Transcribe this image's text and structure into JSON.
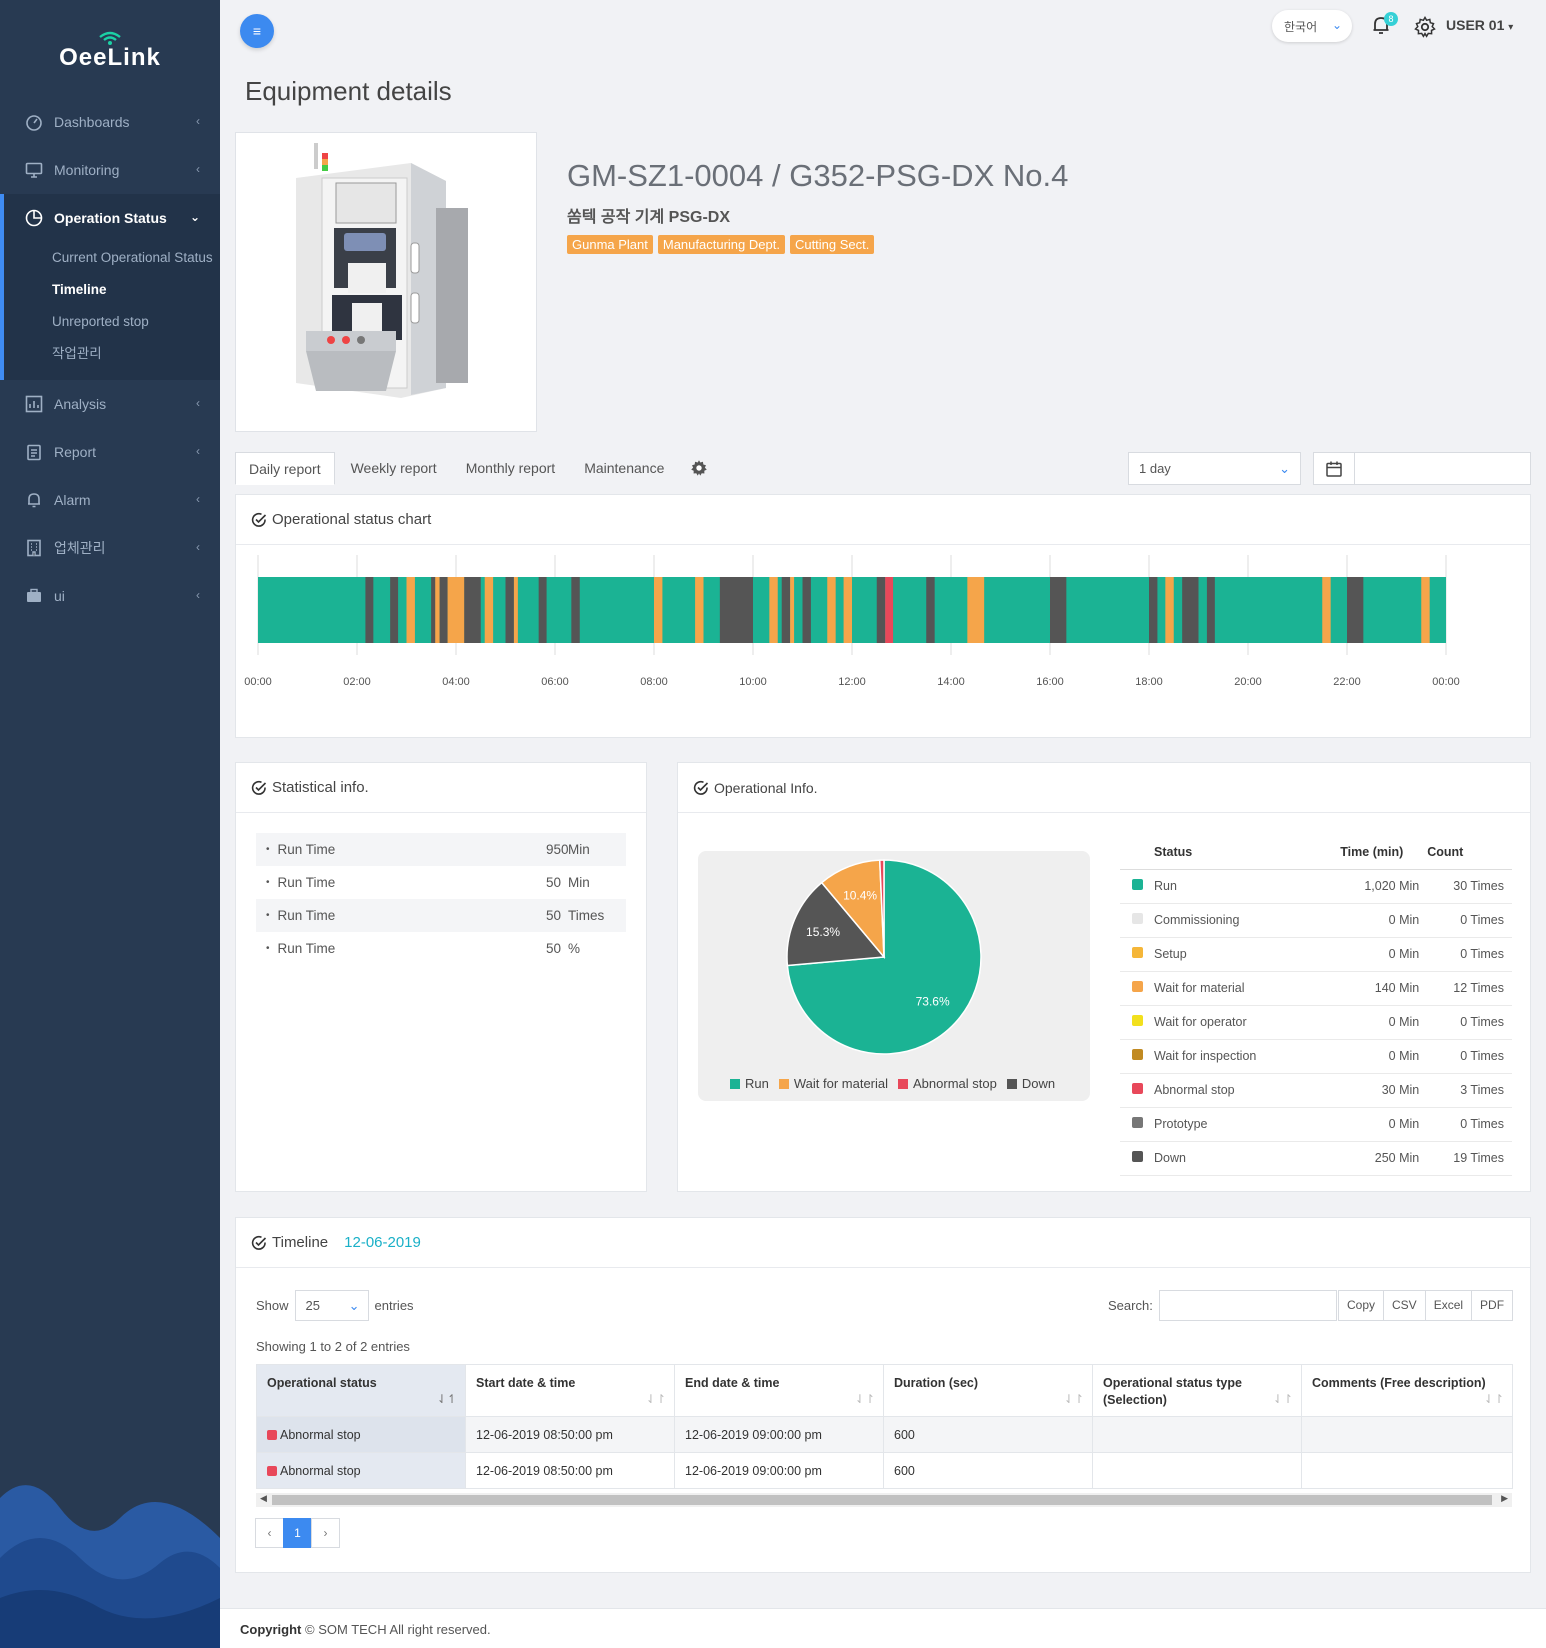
{
  "app": {
    "logo": "OeeLink"
  },
  "sidebar": {
    "items": [
      {
        "label": "Dashboards"
      },
      {
        "label": "Monitoring"
      },
      {
        "label": "Operation Status"
      },
      {
        "label": "Analysis"
      },
      {
        "label": "Report"
      },
      {
        "label": "Alarm"
      },
      {
        "label": "업체관리"
      },
      {
        "label": "ui"
      }
    ],
    "sub_items": [
      {
        "label": "Current Operational Status"
      },
      {
        "label": "Timeline"
      },
      {
        "label": "Unreported stop"
      },
      {
        "label": "작업관리"
      }
    ]
  },
  "topbar": {
    "language": "한국어",
    "notifications": "8",
    "user": "USER 01"
  },
  "page": {
    "title": "Equipment details"
  },
  "equipment": {
    "name": "GM-SZ1-0004 / G352-PSG-DX No.4",
    "subtitle": "쏨텍 공작 기계 PSG-DX",
    "tags": [
      "Gunma Plant",
      "Manufacturing Dept.",
      "Cutting Sect."
    ]
  },
  "tabs": [
    "Daily report",
    "Weekly report",
    "Monthly report",
    "Maintenance"
  ],
  "range": {
    "value": "1 day"
  },
  "status_chart": {
    "title": "Operational status chart",
    "ticks": [
      "00:00",
      "02:00",
      "04:00",
      "06:00",
      "08:00",
      "10:00",
      "12:00",
      "14:00",
      "16:00",
      "18:00",
      "20:00",
      "22:00",
      "00:00"
    ],
    "colors": {
      "run": "#1bb394",
      "wait": "#f5a54a",
      "down": "#555555",
      "abnormal": "#e8485a"
    },
    "segments": [
      {
        "s": 2.17,
        "e": 2.33,
        "t": "down"
      },
      {
        "s": 2.67,
        "e": 2.83,
        "t": "down"
      },
      {
        "s": 3.0,
        "e": 3.17,
        "t": "wait"
      },
      {
        "s": 3.5,
        "e": 3.67,
        "t": "down"
      },
      {
        "s": 3.5,
        "e": 3.67,
        "t": "down"
      },
      {
        "s": 3.58,
        "e": 3.67,
        "t": "wait"
      },
      {
        "s": 3.67,
        "e": 3.83,
        "t": "down"
      },
      {
        "s": 3.83,
        "e": 4.17,
        "t": "wait"
      },
      {
        "s": 4.17,
        "e": 4.33,
        "t": "down"
      },
      {
        "s": 4.17,
        "e": 4.17,
        "t": "down"
      },
      {
        "s": 4.17,
        "e": 4.33,
        "t": "down"
      },
      {
        "s": 4.17,
        "e": 4.5,
        "t": "down"
      },
      {
        "s": 4.58,
        "e": 4.75,
        "t": "wait"
      },
      {
        "s": 5.0,
        "e": 5.17,
        "t": "down"
      },
      {
        "s": 5.17,
        "e": 5.25,
        "t": "wait"
      },
      {
        "s": 5.67,
        "e": 5.83,
        "t": "down"
      },
      {
        "s": 6.33,
        "e": 6.5,
        "t": "down"
      },
      {
        "s": 8.0,
        "e": 8.17,
        "t": "wait"
      },
      {
        "s": 8.83,
        "e": 9.0,
        "t": "wait"
      },
      {
        "s": 9.33,
        "e": 10.0,
        "t": "down"
      },
      {
        "s": 10.33,
        "e": 10.5,
        "t": "wait"
      },
      {
        "s": 10.58,
        "e": 10.75,
        "t": "down"
      },
      {
        "s": 10.75,
        "e": 10.83,
        "t": "wait"
      },
      {
        "s": 11.0,
        "e": 11.17,
        "t": "down"
      },
      {
        "s": 11.5,
        "e": 11.67,
        "t": "wait"
      },
      {
        "s": 11.83,
        "e": 12.0,
        "t": "wait"
      },
      {
        "s": 12.5,
        "e": 12.67,
        "t": "down"
      },
      {
        "s": 12.67,
        "e": 12.83,
        "t": "abnormal"
      },
      {
        "s": 13.5,
        "e": 13.67,
        "t": "down"
      },
      {
        "s": 14.33,
        "e": 14.67,
        "t": "wait"
      },
      {
        "s": 16.0,
        "e": 16.33,
        "t": "down"
      },
      {
        "s": 18.0,
        "e": 18.17,
        "t": "down"
      },
      {
        "s": 18.33,
        "e": 18.5,
        "t": "wait"
      },
      {
        "s": 18.67,
        "e": 19.0,
        "t": "down"
      },
      {
        "s": 19.17,
        "e": 19.33,
        "t": "down"
      },
      {
        "s": 21.5,
        "e": 21.67,
        "t": "wait"
      },
      {
        "s": 22.0,
        "e": 22.33,
        "t": "down"
      },
      {
        "s": 23.5,
        "e": 23.67,
        "t": "wait"
      }
    ]
  },
  "statistics": {
    "title": "Statistical info.",
    "rows": [
      {
        "label": "Run Time",
        "value": "950",
        "unit": "Min"
      },
      {
        "label": "Run Time",
        "value": "50",
        "unit": "Min"
      },
      {
        "label": "Run Time",
        "value": "50",
        "unit": "Times"
      },
      {
        "label": "Run Time",
        "value": "50",
        "unit": "%"
      }
    ]
  },
  "operational_info": {
    "title": "Operational Info.",
    "columns": [
      "Status",
      "Time (min)",
      "Count"
    ],
    "rows": [
      {
        "color": "#1bb394",
        "status": "Run",
        "time": "1,020 Min",
        "count": "30 Times"
      },
      {
        "color": "#e6e6e6",
        "status": "Commissioning",
        "time": "0 Min",
        "count": "0 Times"
      },
      {
        "color": "#f5b638",
        "status": "Setup",
        "time": "0 Min",
        "count": "0 Times"
      },
      {
        "color": "#f5a54a",
        "status": "Wait for material",
        "time": "140 Min",
        "count": "12 Times"
      },
      {
        "color": "#f2e01d",
        "status": "Wait for operator",
        "time": "0 Min",
        "count": "0 Times"
      },
      {
        "color": "#c18a22",
        "status": "Wait for inspection",
        "time": "0 Min",
        "count": "0 Times"
      },
      {
        "color": "#e8485a",
        "status": "Abnormal stop",
        "time": "30 Min",
        "count": "3 Times"
      },
      {
        "color": "#777777",
        "status": "Prototype",
        "time": "0 Min",
        "count": "0 Times"
      },
      {
        "color": "#555555",
        "status": "Down",
        "time": "250 Min",
        "count": "19 Times"
      }
    ]
  },
  "chart_data": {
    "type": "pie",
    "categories": [
      "Run",
      "Wait for material",
      "Abnormal stop",
      "Down"
    ],
    "values": [
      73.6,
      10.4,
      0.7,
      15.3
    ],
    "labels": [
      "73.6%",
      "10.4%",
      "",
      "15.3%"
    ],
    "colors": [
      "#1bb394",
      "#f5a54a",
      "#e8485a",
      "#555555"
    ],
    "legend": "bottom"
  },
  "timeline_table": {
    "title": "Timeline",
    "date": "12-06-2019",
    "show_label": "Show",
    "entries_value": "25",
    "entries_label": "entries",
    "search_label": "Search:",
    "export": [
      "Copy",
      "CSV",
      "Excel",
      "PDF"
    ],
    "info": "Showing 1 to 2 of 2 entries",
    "columns": [
      "Operational status",
      "Start date & time",
      "End date & time",
      "Duration (sec)",
      "Operational status type (Selection)",
      "Comments (Free description)"
    ],
    "rows": [
      {
        "status": "Abnormal stop",
        "start": "12-06-2019 08:50:00 pm",
        "end": "12-06-2019 09:00:00 pm",
        "duration": "600",
        "type": "",
        "comments": ""
      },
      {
        "status": "Abnormal stop",
        "start": "12-06-2019 08:50:00 pm",
        "end": "12-06-2019 09:00:00 pm",
        "duration": "600",
        "type": "",
        "comments": ""
      }
    ],
    "page": "1"
  },
  "footer": {
    "copyright_label": "Copyright",
    "text": "© SOM TECH All right reserved."
  }
}
